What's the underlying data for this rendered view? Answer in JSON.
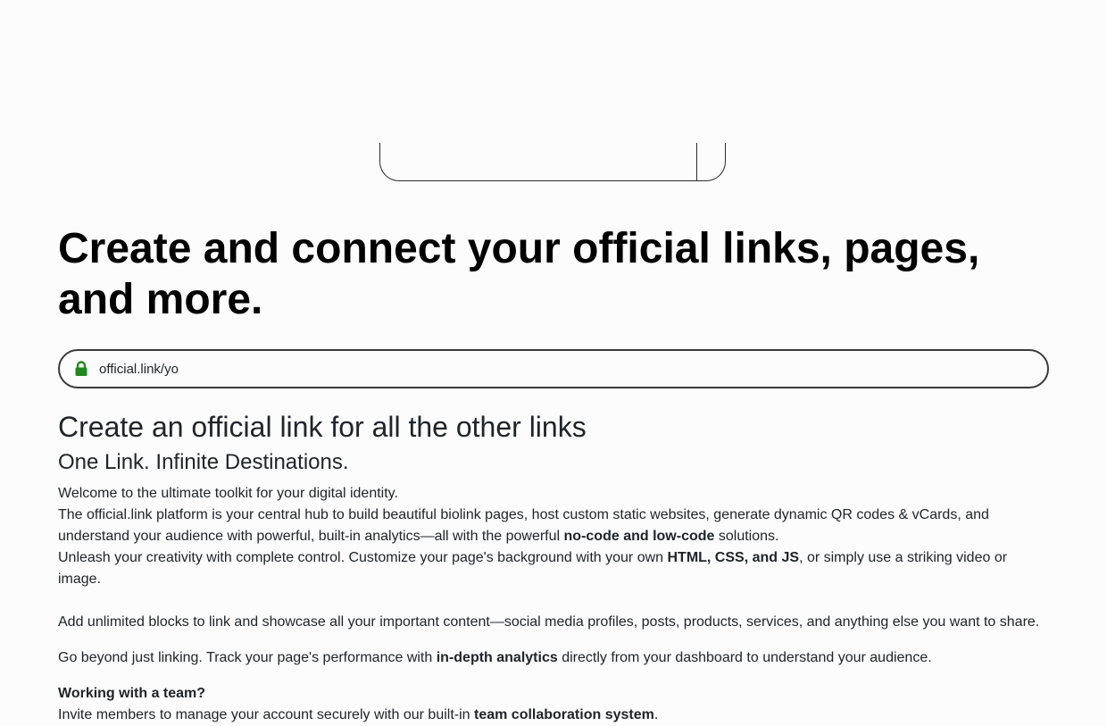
{
  "hero": {
    "title": "Create and connect your official links, pages, and more."
  },
  "url_bar": {
    "icon": "lock-icon",
    "icon_color": "#1e8a1e",
    "value": "official.link/yo"
  },
  "content": {
    "heading": "Create an official link for all the other links",
    "subheading": "One Link. Infinite Destinations.",
    "welcome": "Welcome to the ultimate toolkit for your digital identity.",
    "platform_before": "The official.link platform is your central hub to build beautiful biolink pages, host custom static websites, generate dynamic QR codes & vCards, and understand your audience with powerful, built-in analytics—all with the powerful ",
    "platform_bold": "no-code and low-code",
    "platform_after": " solutions.",
    "creativity_before": "Unleash your creativity with complete control. Customize your page's background with your own ",
    "creativity_bold": "HTML, CSS, and JS",
    "creativity_after": ", or simply use a striking video or image.",
    "blocks": "Add unlimited blocks to link and showcase all your important content—social media profiles, posts, products, services, and anything else you want to share.",
    "analytics_before": "Go beyond just linking. Track your page's performance with ",
    "analytics_bold": "in-depth analytics",
    "analytics_after": " directly from your dashboard to understand your audience.",
    "team_heading": "Working with a team?",
    "team_before": "Invite members to manage your account securely with our built-in ",
    "team_bold": "team collaboration system",
    "team_after": "."
  }
}
